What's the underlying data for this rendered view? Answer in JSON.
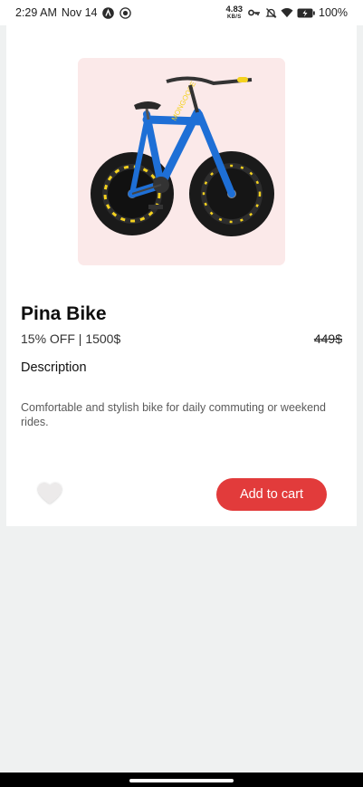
{
  "status_bar": {
    "time": "2:29 AM",
    "date": "Nov 14",
    "net_speed_value": "4.83",
    "net_speed_unit": "KB/S",
    "battery": "100%"
  },
  "product": {
    "name": "Pina Bike",
    "discount_line": "15% OFF | 1500$",
    "old_price": "449$",
    "description_heading": "Description",
    "description": "Comfortable and stylish bike for daily commuting or weekend rides.",
    "image_alt": "blue fat-tire bike",
    "add_to_cart_label": "Add to cart"
  },
  "colors": {
    "accent": "#e23b3b",
    "image_bg": "#fbe9e9",
    "bike_frame": "#1e6fd6",
    "bike_accent": "#f4d21f",
    "page_bg": "#eff1f1"
  }
}
